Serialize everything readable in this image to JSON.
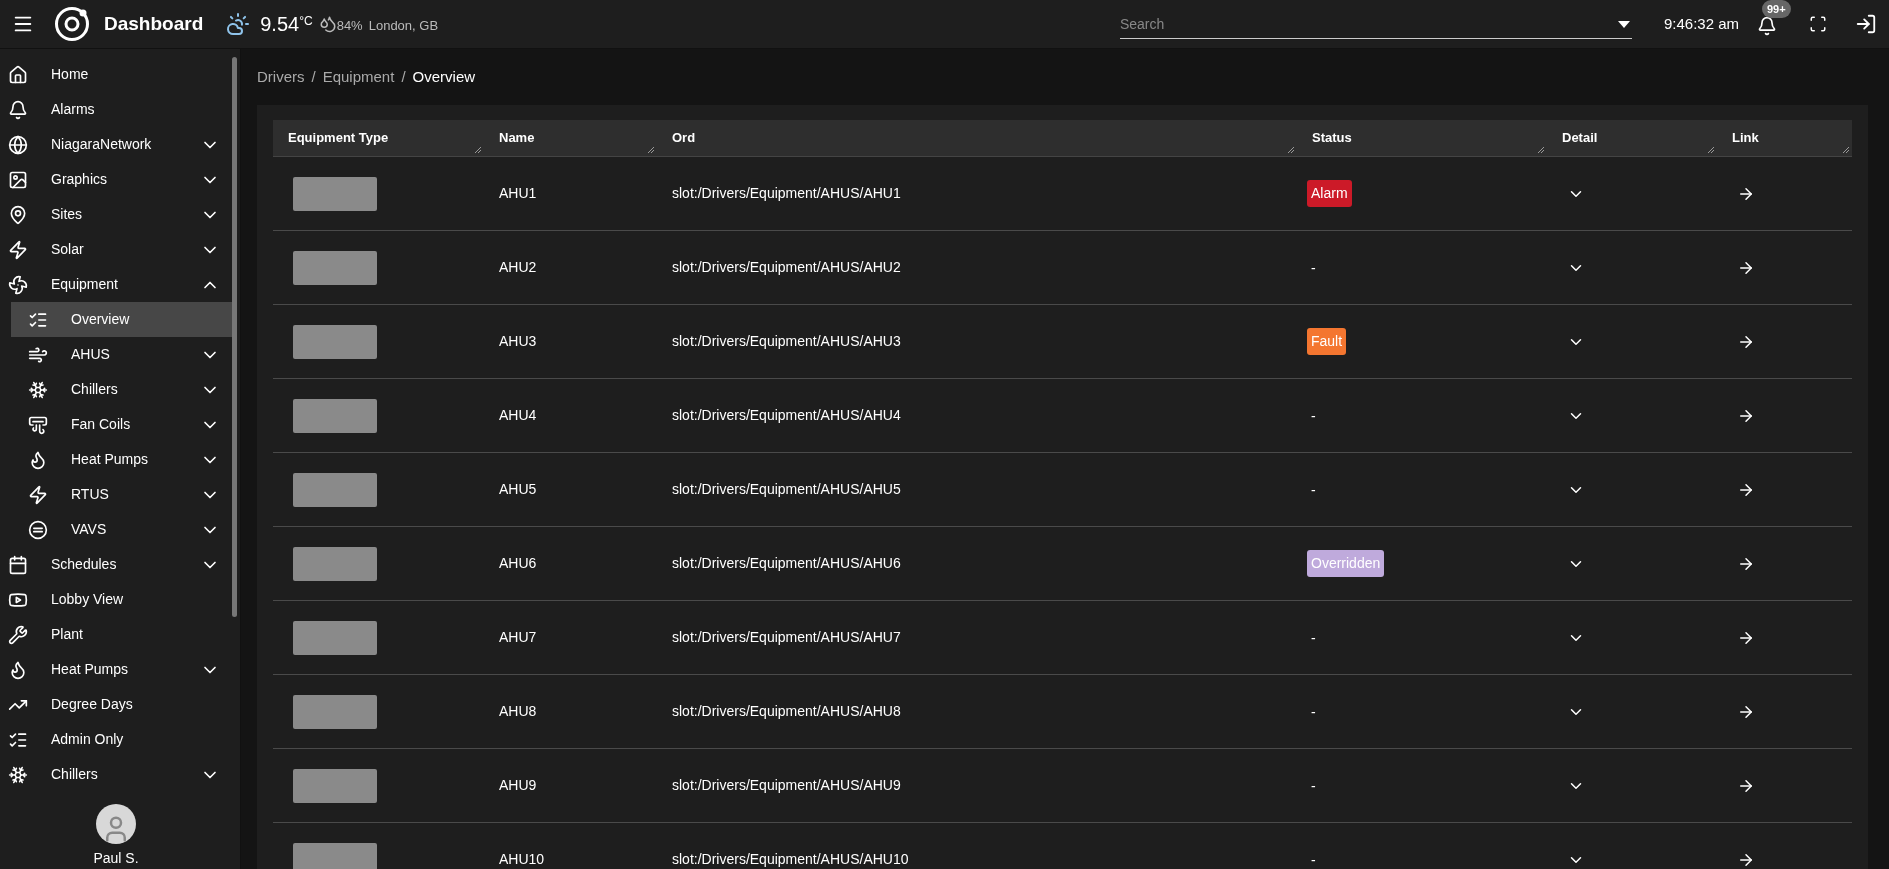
{
  "topbar": {
    "title": "Dashboard",
    "weather": {
      "temperature": "9.54",
      "unit": "°C",
      "humidity": "84%",
      "location": "London, GB"
    },
    "search": {
      "placeholder": "Search"
    },
    "time": "9:46:32 am",
    "notifications": "99+"
  },
  "sidebar": {
    "items": [
      {
        "label": "Home"
      },
      {
        "label": "Alarms"
      },
      {
        "label": "NiagaraNetwork",
        "expanded": false
      },
      {
        "label": "Graphics",
        "expanded": false
      },
      {
        "label": "Sites",
        "expanded": false
      },
      {
        "label": "Solar",
        "expanded": false
      },
      {
        "label": "Equipment",
        "expanded": true,
        "children": [
          {
            "label": "Overview",
            "selected": true
          },
          {
            "label": "AHUS",
            "selected": false,
            "expanded": false
          },
          {
            "label": "Chillers",
            "selected": false,
            "expanded": false
          },
          {
            "label": "Fan Coils",
            "selected": false,
            "expanded": false
          },
          {
            "label": "Heat Pumps",
            "selected": false,
            "expanded": false
          },
          {
            "label": "RTUS",
            "selected": false,
            "expanded": false
          },
          {
            "label": "VAVS",
            "selected": false,
            "expanded": false
          }
        ]
      },
      {
        "label": "Schedules",
        "expanded": false
      },
      {
        "label": "Lobby View"
      },
      {
        "label": "Plant"
      },
      {
        "label": "Heat Pumps",
        "expanded": false
      },
      {
        "label": "Degree Days"
      },
      {
        "label": "Admin Only"
      },
      {
        "label": "Chillers",
        "expanded": false
      }
    ],
    "user": {
      "name": "Paul S."
    }
  },
  "breadcrumb": {
    "items": [
      "Drivers",
      "Equipment",
      "Overview"
    ],
    "separator": "/"
  },
  "table": {
    "columns": [
      "Equipment Type",
      "Name",
      "Ord",
      "Status",
      "Detail",
      "Link"
    ],
    "rows": [
      {
        "name": "AHU1",
        "ord": "slot:/Drivers/Equipment/AHUS/AHU1",
        "status": {
          "kind": "badge",
          "text": "Alarm",
          "color": "#cc1a28"
        }
      },
      {
        "name": "AHU2",
        "ord": "slot:/Drivers/Equipment/AHUS/AHU2",
        "status": {
          "kind": "text",
          "text": "-"
        }
      },
      {
        "name": "AHU3",
        "ord": "slot:/Drivers/Equipment/AHUS/AHU3",
        "status": {
          "kind": "badge",
          "text": "Fault",
          "color": "#f47630"
        }
      },
      {
        "name": "AHU4",
        "ord": "slot:/Drivers/Equipment/AHUS/AHU4",
        "status": {
          "kind": "text",
          "text": "-"
        }
      },
      {
        "name": "AHU5",
        "ord": "slot:/Drivers/Equipment/AHUS/AHU5",
        "status": {
          "kind": "text",
          "text": "-"
        }
      },
      {
        "name": "AHU6",
        "ord": "slot:/Drivers/Equipment/AHUS/AHU6",
        "status": {
          "kind": "badge",
          "text": "Overridden",
          "color": "#bfaadc"
        }
      },
      {
        "name": "AHU7",
        "ord": "slot:/Drivers/Equipment/AHUS/AHU7",
        "status": {
          "kind": "text",
          "text": "-"
        }
      },
      {
        "name": "AHU8",
        "ord": "slot:/Drivers/Equipment/AHUS/AHU8",
        "status": {
          "kind": "text",
          "text": "-"
        }
      },
      {
        "name": "AHU9",
        "ord": "slot:/Drivers/Equipment/AHUS/AHU9",
        "status": {
          "kind": "text",
          "text": "-"
        }
      },
      {
        "name": "AHU10",
        "ord": "slot:/Drivers/Equipment/AHUS/AHU10",
        "status": {
          "kind": "text",
          "text": "-"
        }
      }
    ]
  }
}
